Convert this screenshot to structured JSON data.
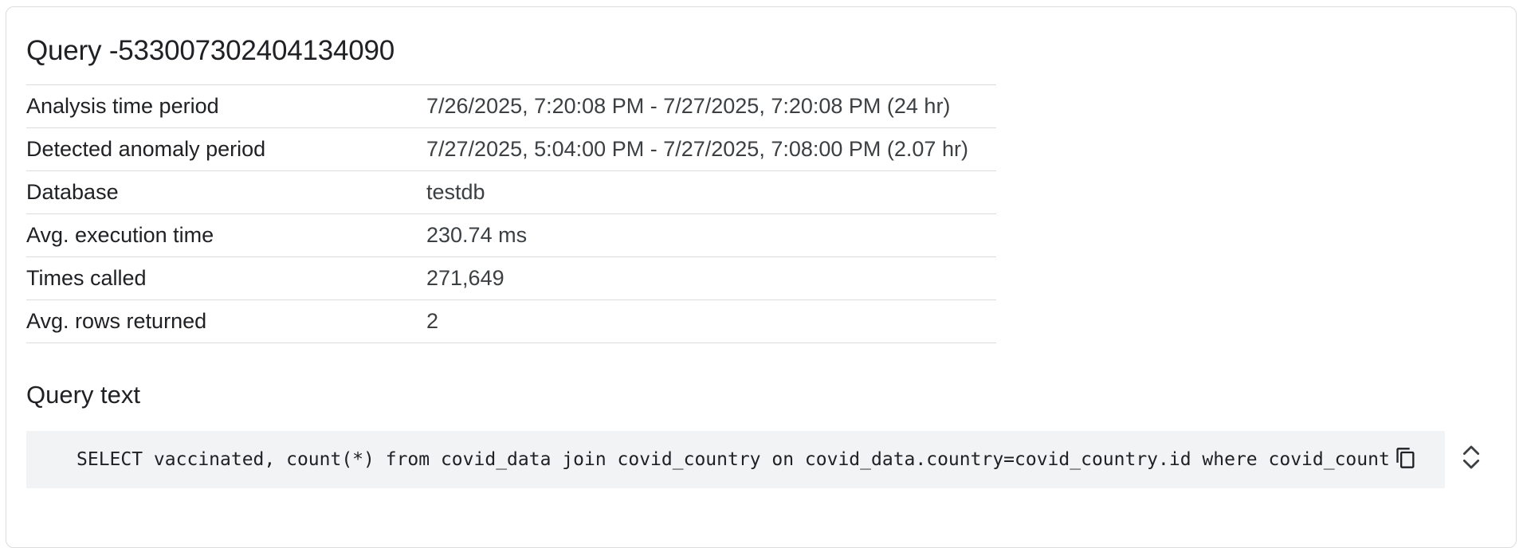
{
  "query": {
    "title": "Query -5330073024041340​90"
  },
  "details": {
    "rows": [
      {
        "label": "Analysis time period",
        "value": "7/26/2025, 7:20:08 PM - 7/27/2025, 7:20:08 PM (24 hr)"
      },
      {
        "label": "Detected anomaly period",
        "value": "7/27/2025, 5:04:00 PM - 7/27/2025, 7:08:00 PM (2.07 hr)"
      },
      {
        "label": "Database",
        "value": "testdb"
      },
      {
        "label": "Avg. execution time",
        "value": "230.74 ms"
      },
      {
        "label": "Times called",
        "value": "271,649"
      },
      {
        "label": "Avg. rows returned",
        "value": "2"
      }
    ]
  },
  "query_text": {
    "heading": "Query text",
    "sql": "SELECT vaccinated, count(*) from covid_data join covid_country on covid_data.country=covid_country.id where covid_country",
    "copy_icon": "copy-icon",
    "expand_icon": "unfold-more-icon"
  },
  "colors": {
    "code_background": "#f1f3f4",
    "divider": "#dadce0"
  }
}
